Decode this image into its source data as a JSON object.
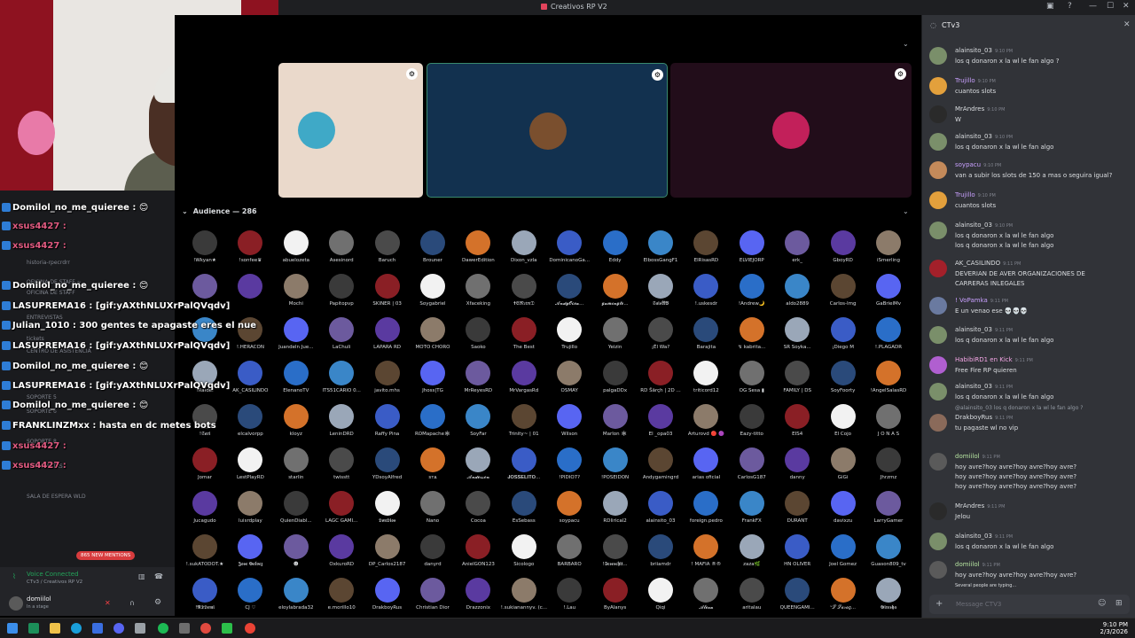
{
  "window": {
    "title": "Creativos RP V2"
  },
  "stage": {
    "tiles": [
      {
        "bg": "#ead9cb",
        "avatar_color": "#3fa9c7"
      },
      {
        "bg": "#12314f",
        "avatar_color": "#7a4f2e",
        "selected": true
      },
      {
        "bg": "#220d1a",
        "avatar_color": "#c2205a"
      }
    ]
  },
  "audience": {
    "label": "Audience — 286",
    "members": [
      [
        "!Wkyan★",
        "!sonfee♛",
        "abuelozeta",
        "Asesinord",
        "Baruch",
        "Brouner",
        "DawerEdition",
        "Dixon_vzla",
        "DominicanoGa...",
        "Eddy",
        "ElbossGangF1",
        "ElRisasRD",
        "ELVIEJORP",
        "erk_",
        "GboyRD",
        "iSmerling"
      ],
      [
        "",
        "",
        "Mochi",
        "Papitopvp",
        "SKINER | 03",
        "Soygabriel",
        "Xfaceking",
        "🕇𝔈𝔩𝔑𝔢𝔱𝔬𝔯𝔇",
        "𝓐𝓷𝓭𝔂𝓞𝓬𝓮𝓪...",
        "𝓰𝓪𝓶𝓲𝓷𝓰𝓽𝓸...",
        "𝕾𝖆𝖎𝖘𝕬𝕭",
        "!.uskesdr",
        "!Andrew🌙",
        "aldo2889",
        "Carlos-Img",
        "GaBrielMv"
      ],
      [
        "",
        "!.HERACON",
        "Juandeln Jue...",
        "LaChuli",
        "LAPARA RD",
        "MOTO CHORO",
        "Saoko",
        "The Best",
        "Trujillo",
        "Yeizin",
        "¡Él Wa?",
        "Barajita",
        "↯ kabrita...",
        "SR Soyka...",
        "¡Diego M",
        "!.PLAGADR"
      ],
      [
        "!Raidel",
        "AK_CASILINDO",
        "ElenanoTV",
        "ITS51CARIO 0...",
        "javito.mhs",
        "Jhoss|TG",
        "MrReyesRD",
        "MrVargasRd",
        "OSMAY",
        "palgaDDx",
        "RD Šārçh | 2D ...",
        "triticord12",
        "OG Sesa ▮",
        "FAMILY | DS",
        "SoyFoorty",
        "!AngelSalasRD"
      ],
      [
        "!𝕾𝖆𝖗𝖎",
        "elcalvorpp",
        "kloyz",
        "LeninDRD",
        "Raffy Pina",
        "ROMapache🕸",
        "SoyFar",
        "Trinity~ | 01",
        "Wilson",
        "Marlon 🕸",
        "El _opa03",
        "Arturovd 🔴 🟣",
        "Eazy-titto",
        "EIS4",
        "El Cojo",
        "J O N A S"
      ],
      [
        "Jomar",
        "LestPlayRD",
        "starlin",
        "twisstt",
        "YDsoyAlfred",
        "ꜱᴛᴀ",
        "𝓐𝓷𝓭𝓮𝓻𝓼𝓸𝓷",
        "𝐉𝐎𝐒𝐒𝐄𝐋𝐈𝐓𝐎...",
        "!PIDIO7?",
        "!POSEIDON",
        "Andygamingrd",
        "arias oficial",
        "CarlosG187",
        "danny",
        "GiGi",
        "Jhrzmz"
      ],
      [
        "Jucagudo",
        "luisrdplay",
        "QuienDiabl...",
        "LAGC GAMI...",
        "𝕯𝖔𝖓𝕯𝖎𝖔𝖘",
        "Nano",
        "Cocoa",
        "EsSebass",
        "soypacu",
        "RDlirical2",
        "alainsito_03",
        "foreign.pedro",
        "FrankFX",
        "DURANT",
        "davixzu",
        "LarryGamer"
      ],
      [
        "!.sukATODOT.★",
        "𝕵𝖔𝖘𝖊 𝕲𝖆𝖑𝖛𝖊𝖟",
        "☻",
        "OxkuroRD",
        "DP_Carlos2187",
        "danyrd",
        "AnielGON123",
        "Sicologo",
        "BARBARO",
        "!𝕴𝖊𝖘𝖊𝖘𝖈𝖍𝖎𝖙...",
        "briiamdr",
        "! MAFIA ®®",
        "zaza🌿",
        "HN OLIVER",
        "Joel Gomez",
        "Guason809_tv"
      ],
      [
        "!𝕽𝕯𝕯𝖊𝖒𝖎",
        "CJ ♡",
        "eloylabrada32",
        "e.morillo10",
        "DrakboyRus",
        "Christian Dior",
        "Drazzonix",
        "!.sukianannyv. (c...",
        "!.Lau",
        "ByAlanys",
        "Qiqi",
        "𝓐𝓵𝓮𝔁𝓪",
        "aritalau",
        "QUEENGAMI...",
        "ᵛ𝒮 𝒮𝒶𝓇𝒶𝑔...",
        "𝕲𝖎𝖗𝖊𝖘𝖍𝖆"
      ]
    ]
  },
  "overlay_chat": [
    {
      "text": "Domilol_no_me_quieree : 😊 "
    },
    {
      "text": "xsus4427 : "
    },
    {
      "text": "xsus4427 : "
    },
    {
      "text": "Domilol_no_me_quieree : 😊 "
    },
    {
      "text": "LASUPREMA16 : [gif:yAXthNLUXrPalQVqdv]"
    },
    {
      "text": "Julian_1010 : 300 gentes te apagaste eres el nue"
    },
    {
      "text": "LASUPREMA16 : [gif:yAXthNLUXrPalQVqdv]"
    },
    {
      "text": "Domilol_no_me_quieree : 😊 "
    },
    {
      "text": "LASUPREMA16 : [gif:yAXthNLUXrPalQVqdv]"
    },
    {
      "text": "Domilol_no_me_quieree : 😊 "
    },
    {
      "text": "FRANKLINZMxx : hasta en dc metes bots"
    },
    {
      "text": "xsus4427 : "
    },
    {
      "text": "xsus4427 : "
    }
  ],
  "channels": [
    "historia-rpecrdrr",
    "OFICINA DE STAFF ~",
    "OFICINA DE STAFF",
    "ENTREVISTAS",
    "SOPORTE 4",
    "SOPORTE 5",
    "SOPORTE 6",
    "SOPORTE 7",
    "SOPORTE 8",
    "ENTREVISTAS",
    "SALA DE ESPERA WLD",
    "CENTRO DE ASISTENCIA",
    "tickets"
  ],
  "new_mentions": "865 NEW MENTIONS",
  "voice": {
    "status": "Voice Connected",
    "channel": "CTv3 / Creativos RP V2",
    "user": "domiilol",
    "user_sub": "In a stage"
  },
  "panel": {
    "channel": "CTv3",
    "messages": [
      {
        "author": "alainsito_03",
        "color": "#dbdee1",
        "time": "9:10 PM",
        "lines": [
          "los q donaron x la wl le fan algo ?"
        ],
        "avatar": "#7a8f6a"
      },
      {
        "author": "Trujillo",
        "color": "#c9a0ff",
        "time": "9:10 PM",
        "lines": [
          "cuantos slots"
        ],
        "avatar": "#e3a03c"
      },
      {
        "author": "MrAndres",
        "color": "#dbdee1",
        "time": "9:10 PM",
        "lines": [
          "W"
        ],
        "avatar": "#2a2a2a"
      },
      {
        "author": "alainsito_03",
        "color": "#dbdee1",
        "time": "9:10 PM",
        "lines": [
          "los q donaron x la wl le fan algo"
        ],
        "avatar": "#7a8f6a"
      },
      {
        "author": "soypacu",
        "color": "#c9a0ff",
        "time": "9:10 PM",
        "lines": [
          "van a subir los slots de 150 a mas o seguira igual?"
        ],
        "avatar": "#c48a5a"
      },
      {
        "author": "Trujillo",
        "color": "#c9a0ff",
        "time": "9:10 PM",
        "lines": [
          "cuantos slots"
        ],
        "avatar": "#e3a03c"
      },
      {
        "author": "alainsito_03",
        "color": "#dbdee1",
        "time": "9:10 PM",
        "lines": [
          "los q donaron x la wl le fan algo",
          "los q donaron x la wl le fan algo"
        ],
        "avatar": "#7a8f6a"
      },
      {
        "author": "AK_CASILINDO",
        "color": "#dbdee1",
        "time": "9:11 PM",
        "lines": [
          "DEVERIAN DE AVER ORGANIZACIONES DE",
          "CARRERAS INLEGALES"
        ],
        "avatar": "#a3202a"
      },
      {
        "author": "! VoPamka",
        "color": "#c9a0ff",
        "time": "9:11 PM",
        "lines": [
          "E un venao ese 💀💀💀"
        ],
        "avatar": "#6a7aa0"
      },
      {
        "author": "alainsito_03",
        "color": "#dbdee1",
        "time": "9:11 PM",
        "lines": [
          "los q donaron x la wl le fan algo"
        ],
        "avatar": "#7a8f6a"
      },
      {
        "author": "HabibiRD1 en Kick",
        "color": "#f5a6e6",
        "time": "9:11 PM",
        "lines": [
          "Free Fire RP quieren"
        ],
        "avatar": "#b05fd0"
      },
      {
        "author": "alainsito_03",
        "color": "#dbdee1",
        "time": "9:11 PM",
        "lines": [
          "los q donaron x la wl le fan algo"
        ],
        "avatar": "#7a8f6a"
      },
      {
        "author": "DrakboyRus",
        "color": "#dbdee1",
        "time": "9:11 PM",
        "lines": [
          "tu pagaste wl no vip"
        ],
        "avatar": "#8a6a5a",
        "reply": "@alainsito_03 los q donaron x la wl le fan algo ?"
      },
      {
        "author": "domiilol",
        "color": "#b5e3a0",
        "time": "9:11 PM",
        "lines": [
          "hoy avre?hoy avre?hoy avre?hoy avre?",
          "hoy avre?hoy avre?hoy avre?hoy avre?",
          "hoy avre?hoy avre?hoy avre?hoy avre?"
        ],
        "avatar": "#5a5a5a"
      },
      {
        "author": "MrAndres",
        "color": "#dbdee1",
        "time": "9:11 PM",
        "lines": [
          "Jelou"
        ],
        "avatar": "#2a2a2a"
      },
      {
        "author": "alainsito_03",
        "color": "#dbdee1",
        "time": "9:11 PM",
        "lines": [
          "los q donaron x la wl le fan algo"
        ],
        "avatar": "#7a8f6a"
      },
      {
        "author": "domiilol",
        "color": "#b5e3a0",
        "time": "9:11 PM",
        "lines": [
          "hoy avre?hoy avre?hoy avre?hoy avre?"
        ],
        "avatar": "#5a5a5a"
      }
    ],
    "typing": "Several people are typing...",
    "composer_placeholder": "Message CTV3"
  },
  "taskbar": {
    "time": "9:10 PM",
    "date": "2/3/2026"
  }
}
